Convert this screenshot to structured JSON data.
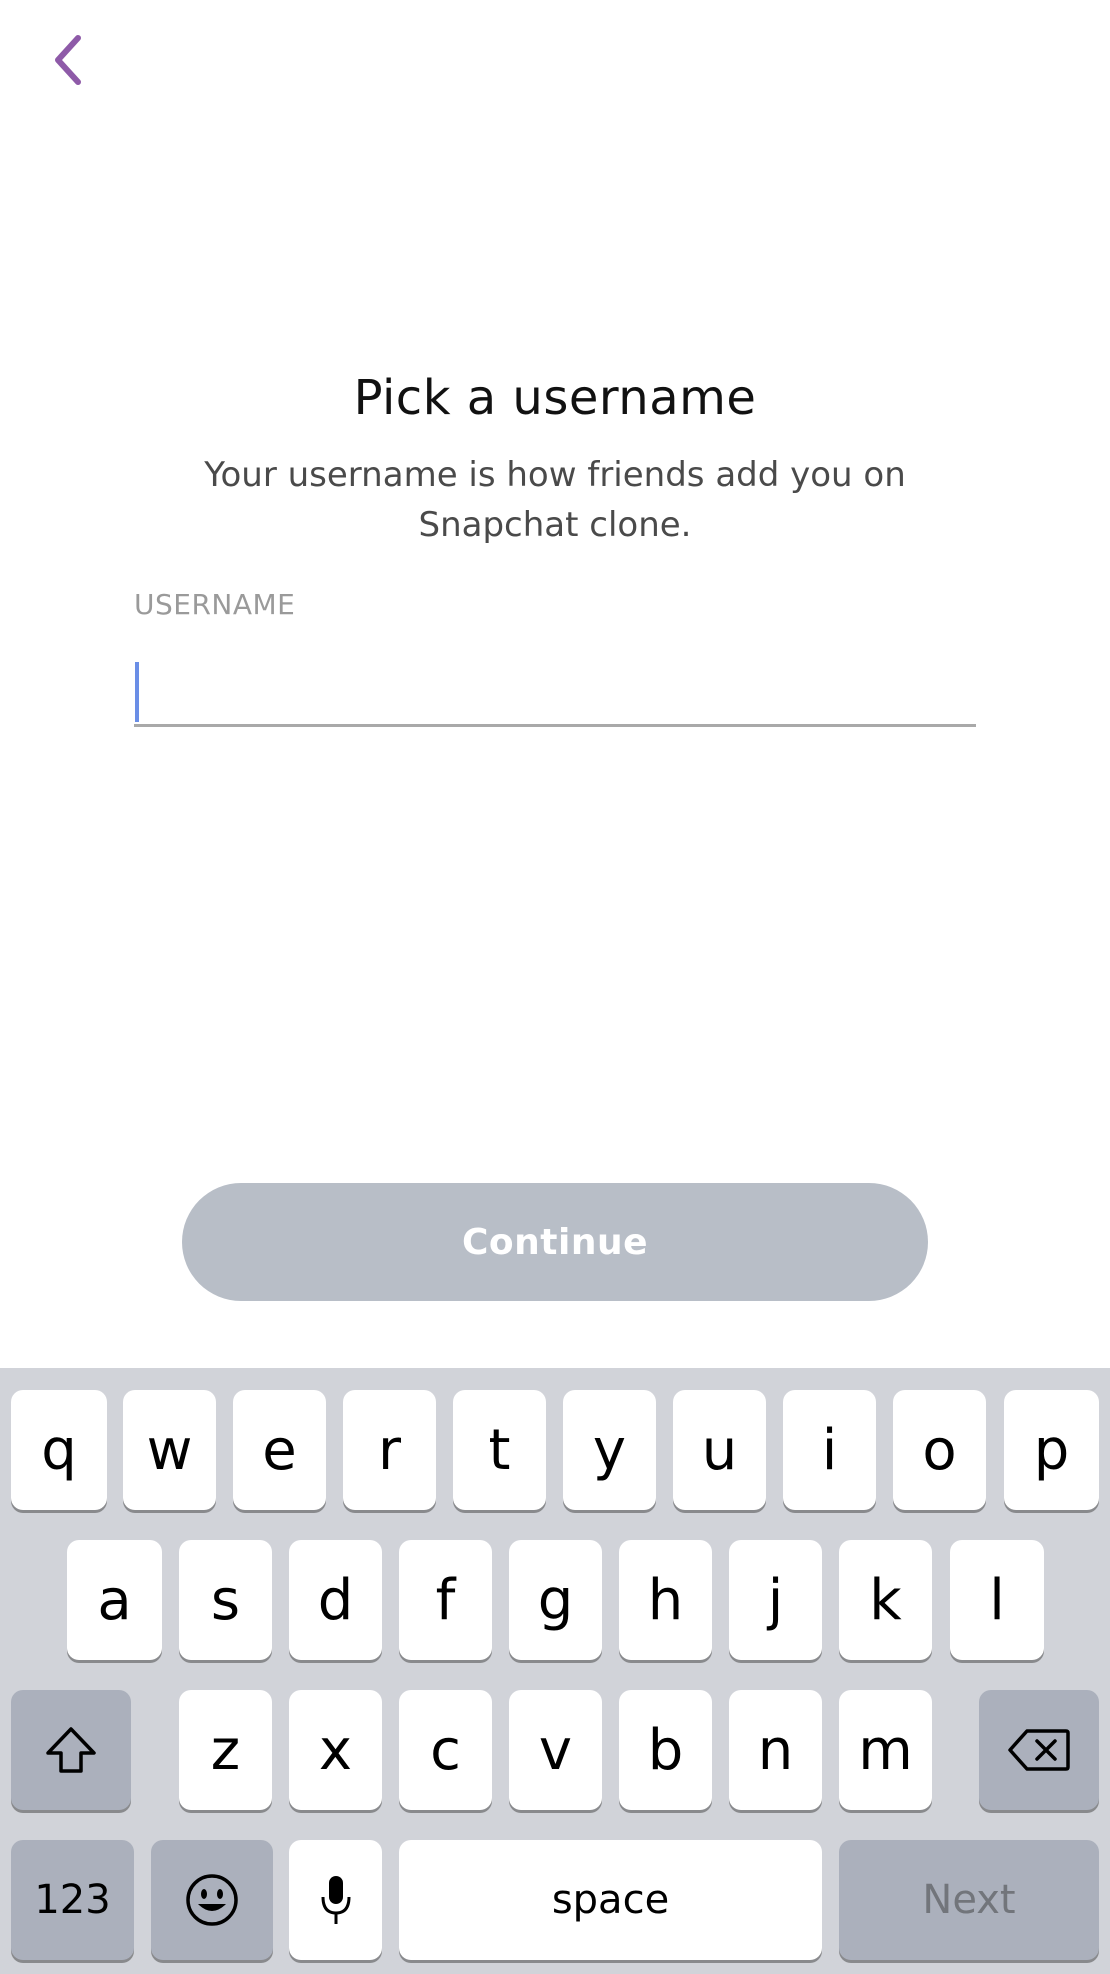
{
  "header": {
    "back_icon": "chevron-left-icon",
    "accent_color": "#8e5aa8"
  },
  "main": {
    "title": "Pick a username",
    "subtitle": "Your username is how friends add you on Snapchat clone.",
    "username_label": "USERNAME",
    "username_value": "",
    "continue_label": "Continue"
  },
  "keyboard": {
    "row1": [
      "q",
      "w",
      "e",
      "r",
      "t",
      "y",
      "u",
      "i",
      "o",
      "p"
    ],
    "row2": [
      "a",
      "s",
      "d",
      "f",
      "g",
      "h",
      "j",
      "k",
      "l"
    ],
    "row3": [
      "z",
      "x",
      "c",
      "v",
      "b",
      "n",
      "m"
    ],
    "shift_icon": "shift-icon",
    "backspace_icon": "backspace-icon",
    "numbers_label": "123",
    "emoji_icon": "emoji-icon",
    "mic_icon": "microphone-icon",
    "space_label": "space",
    "next_label": "Next"
  }
}
